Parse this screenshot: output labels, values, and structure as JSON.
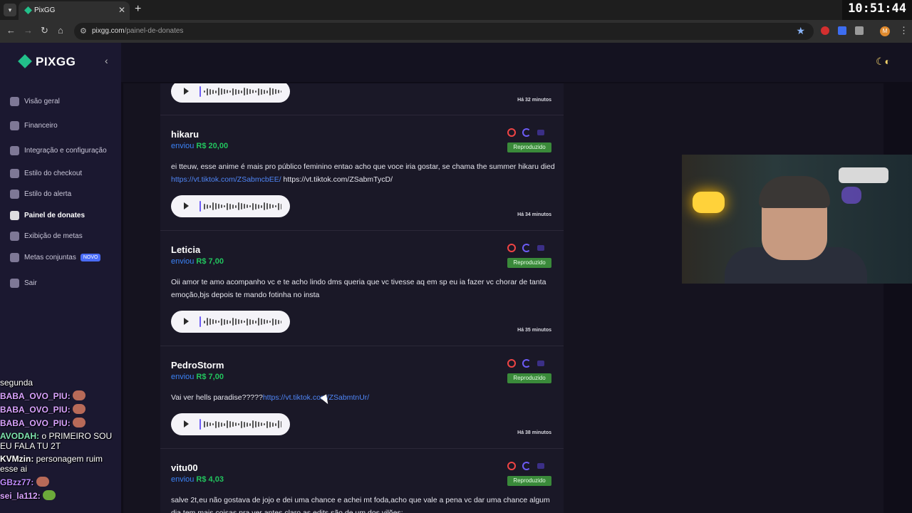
{
  "browser": {
    "tab_title": "PixGG",
    "url_host": "pixgg.com",
    "url_path": "/painel-de-donates",
    "clock": "10:51:44",
    "profile_initial": "M"
  },
  "sidebar": {
    "logo": "PIXGG",
    "items": [
      {
        "label": "Visão geral",
        "icon": "home-icon"
      },
      {
        "label": "Financeiro",
        "icon": "finance-icon"
      },
      {
        "label": "Integração e configuração",
        "icon": "settings-icon"
      },
      {
        "label": "Estilo do checkout",
        "icon": "palette-icon"
      },
      {
        "label": "Estilo do alerta",
        "icon": "palette-icon"
      },
      {
        "label": "Painel de donates",
        "icon": "donate-icon"
      },
      {
        "label": "Exibição de metas",
        "icon": "star-icon"
      },
      {
        "label": "Metas conjuntas",
        "icon": "goal-icon",
        "badge": "NOVO"
      },
      {
        "label": "Sair",
        "icon": "logout-icon"
      }
    ]
  },
  "chat": [
    {
      "user": "",
      "text": "segunda",
      "color": "#ffffff"
    },
    {
      "user": "BABA_OVO_PIU:",
      "text": "",
      "color": "#d9a3ff",
      "emote": true
    },
    {
      "user": "BABA_OVO_PIU:",
      "text": "",
      "color": "#d9a3ff",
      "emote": true
    },
    {
      "user": "BABA_OVO_PIU:",
      "text": "",
      "color": "#d9a3ff",
      "emote": true
    },
    {
      "user": "AVODAH:",
      "text": "o PRIMEIRO SOU EU FALA TU 2T",
      "color": "#7fe6b0"
    },
    {
      "user": "KVMzin:",
      "text": "personagem ruim esse ai",
      "color": "#ffffff"
    },
    {
      "user": "GBzz77:",
      "text": "",
      "color": "#c08cff",
      "emote": true
    },
    {
      "user": "sei_la112:",
      "text": "",
      "color": "#d9a3ff",
      "emote": true,
      "emote_green": true
    }
  ],
  "feed": {
    "sent_label": "enviou",
    "status_label": "Reproduzido",
    "top_time": "Há 32 minutos",
    "donations": [
      {
        "name": "hikaru",
        "amount": "R$ 20,00",
        "message": "ei tteuw, esse anime é mais pro público feminino entao acho que voce iria gostar, se chama the summer hikaru died ",
        "link": "https://vt.tiktok.com/ZSabmcbEE/",
        "message_after": " https://vt.tiktok.com/ZSabmTycD/",
        "time": "Há 34 minutos"
      },
      {
        "name": "Leticia",
        "amount": "R$ 7,00",
        "message": "Oii amor te amo acompanho vc e te acho lindo dms queria que vc tivesse aq em sp eu ia fazer vc chorar de tanta emoção,bjs depois te mando fotinha no insta",
        "link": "",
        "message_after": "",
        "time": "Há 35 minutos"
      },
      {
        "name": "PedroStorm",
        "amount": "R$ 7,00",
        "message": "Vai ver hells paradise?????",
        "link": "https://vt.tiktok.com/ZSabmtnUr/",
        "message_after": "",
        "time": "Há 38 minutos"
      },
      {
        "name": "vitu00",
        "amount": "R$ 4,03",
        "message": "salve 2t,eu não gostava de jojo e dei uma chance e achei mt foda,acho que vale a pena vc dar uma chance algum dia tem mais coisas pra ver antes claro as edits são de um dos vilões:",
        "link": "",
        "message_after": "",
        "time": ""
      }
    ]
  },
  "colors": {
    "accent_green": "#22c55e",
    "link_blue": "#3b82f6",
    "status_green": "#3a8a3a",
    "block_red": "#ef4444"
  }
}
